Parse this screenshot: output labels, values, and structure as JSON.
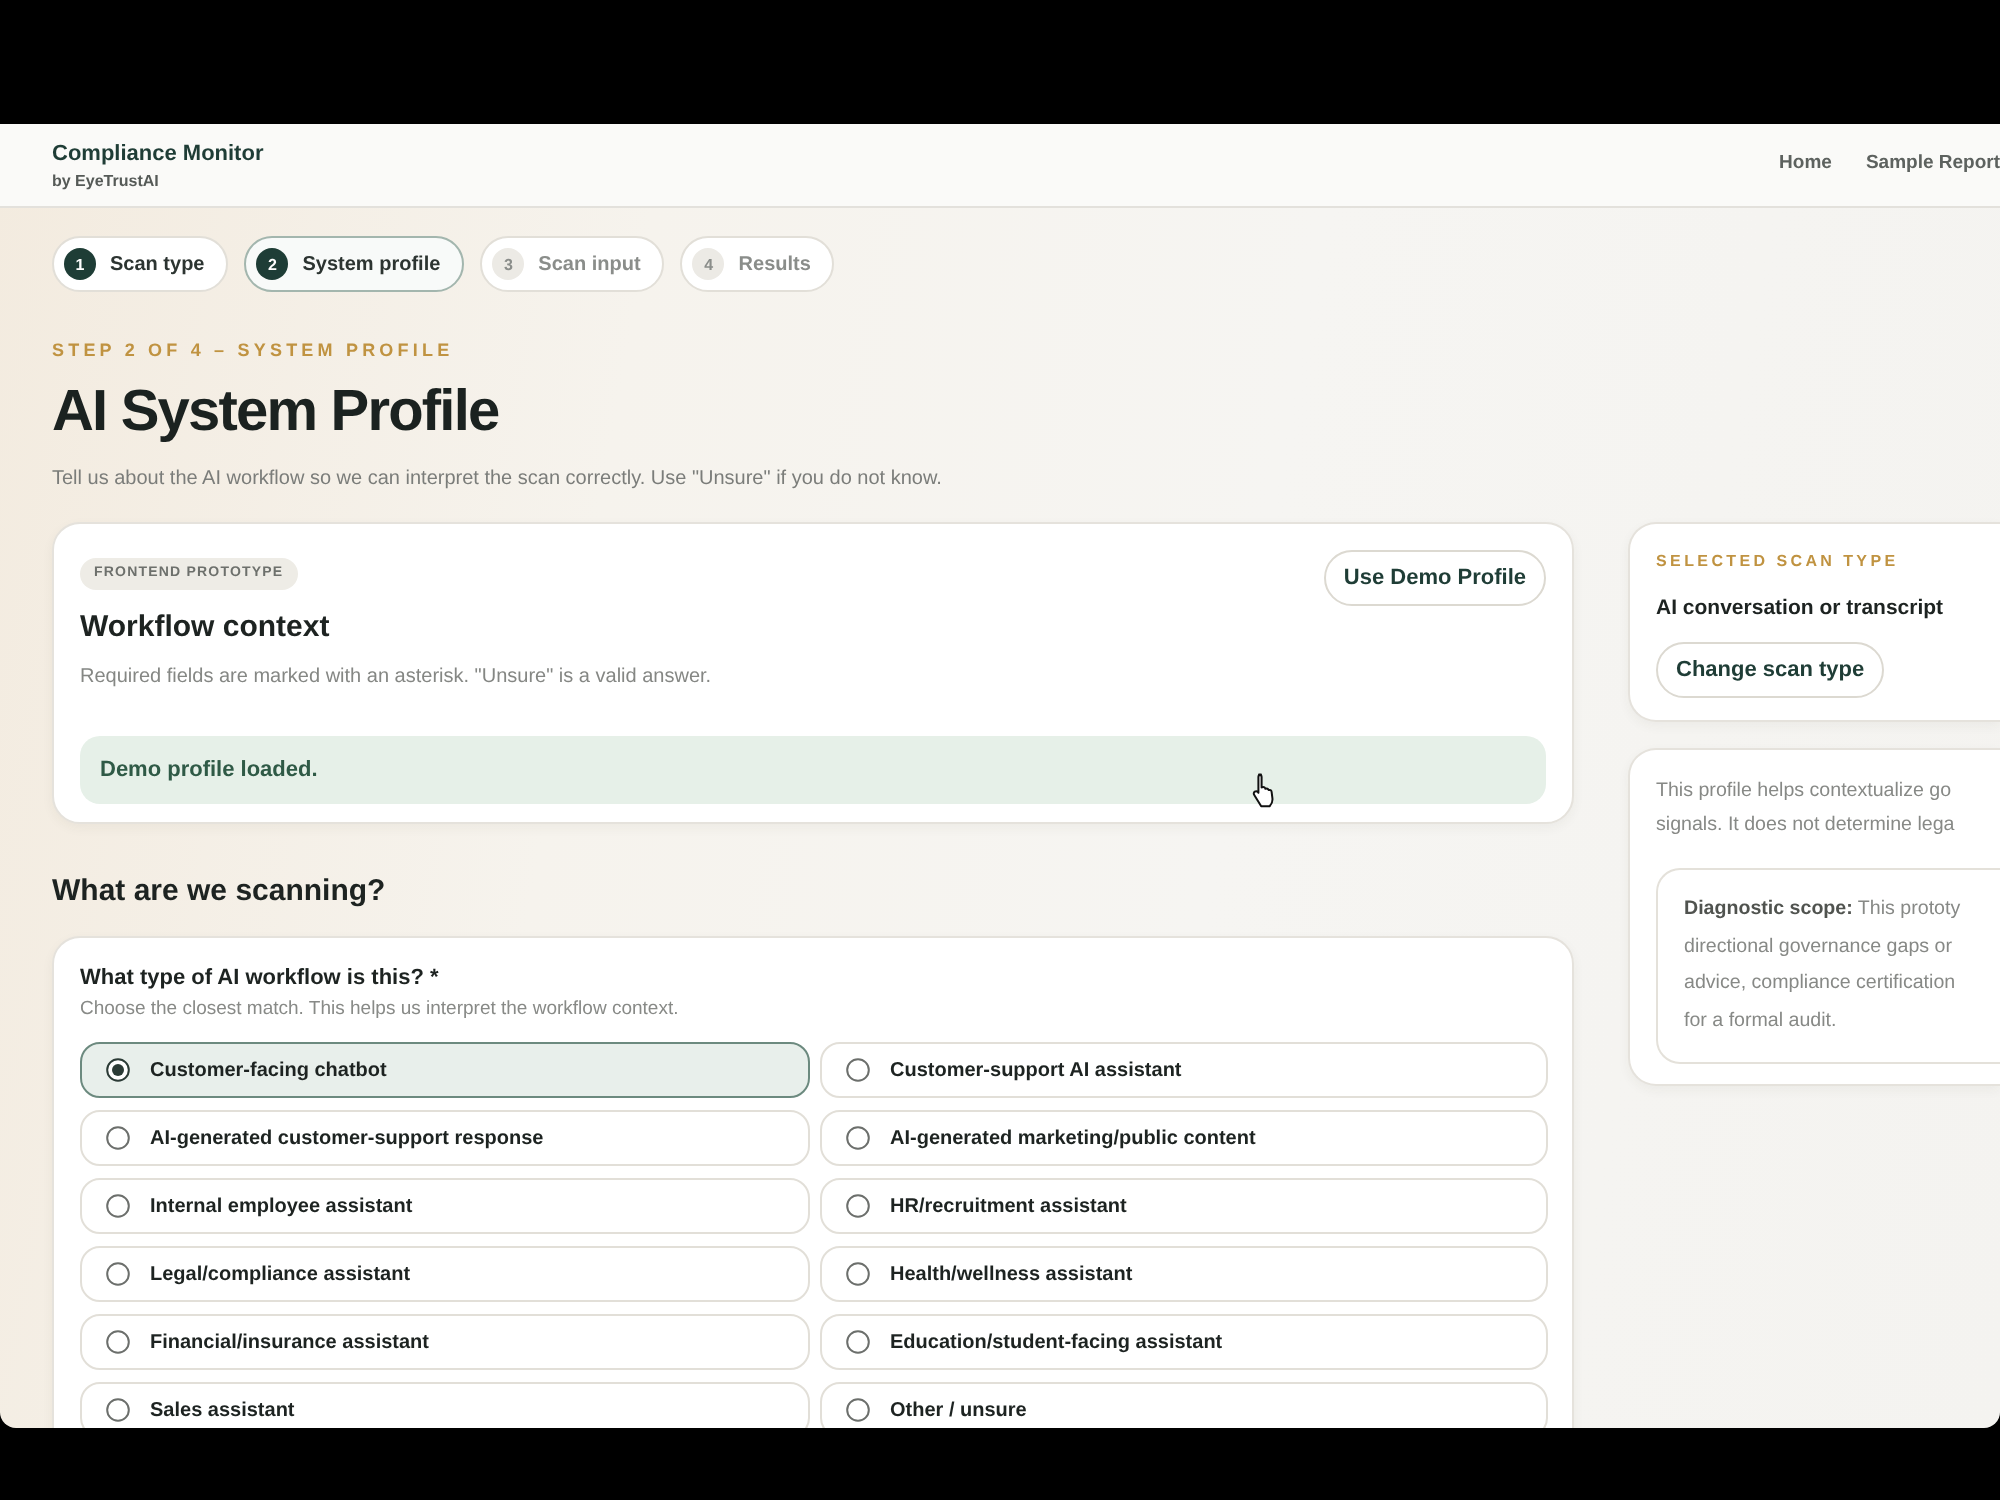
{
  "header": {
    "title": "Compliance Monitor",
    "subtitle": "by EyeTrustAI",
    "nav": [
      {
        "label": "Home"
      },
      {
        "label": "Sample Report"
      }
    ]
  },
  "steps": [
    {
      "number": "1",
      "label": "Scan type",
      "reached": true,
      "selected": false
    },
    {
      "number": "2",
      "label": "System profile",
      "reached": true,
      "selected": true
    },
    {
      "number": "3",
      "label": "Scan input",
      "reached": false,
      "selected": false
    },
    {
      "number": "4",
      "label": "Results",
      "reached": false,
      "selected": false
    }
  ],
  "heading": {
    "eyebrow": "STEP 2 OF 4 – SYSTEM PROFILE",
    "title": "AI System Profile",
    "intro": "Tell us about the AI workflow so we can interpret the scan correctly. Use \"Unsure\" if you do not know."
  },
  "context_card": {
    "badge": "FRONTEND PROTOTYPE",
    "title": "Workflow context",
    "description": "Required fields are marked with an asterisk. \"Unsure\" is a valid answer.",
    "button": "Use Demo Profile",
    "notice": "Demo profile loaded."
  },
  "section_title": "What are we scanning?",
  "question": {
    "label": "What type of AI workflow is this? *",
    "hint": "Choose the closest match. This helps us interpret the workflow context.",
    "options": [
      {
        "label": "Customer-facing chatbot",
        "selected": true
      },
      {
        "label": "Customer-support AI assistant",
        "selected": false
      },
      {
        "label": "AI-generated customer-support response",
        "selected": false
      },
      {
        "label": "AI-generated marketing/public content",
        "selected": false
      },
      {
        "label": "Internal employee assistant",
        "selected": false
      },
      {
        "label": "HR/recruitment assistant",
        "selected": false
      },
      {
        "label": "Legal/compliance assistant",
        "selected": false
      },
      {
        "label": "Health/wellness assistant",
        "selected": false
      },
      {
        "label": "Financial/insurance assistant",
        "selected": false
      },
      {
        "label": "Education/student-facing assistant",
        "selected": false
      },
      {
        "label": "Sales assistant",
        "selected": false
      },
      {
        "label": "Other / unsure",
        "selected": false
      }
    ]
  },
  "sidebar": {
    "scan_type": {
      "eyebrow": "SELECTED SCAN TYPE",
      "value": "AI conversation or transcript",
      "button": "Change scan type"
    },
    "note": {
      "lines": [
        "This profile helps contextualize go",
        "signals. It does not determine lega"
      ],
      "scope_lines": [
        "**Diagnostic scope:** This prototy",
        "directional governance gaps or",
        "advice, compliance certification",
        "for a formal audit."
      ]
    }
  }
}
